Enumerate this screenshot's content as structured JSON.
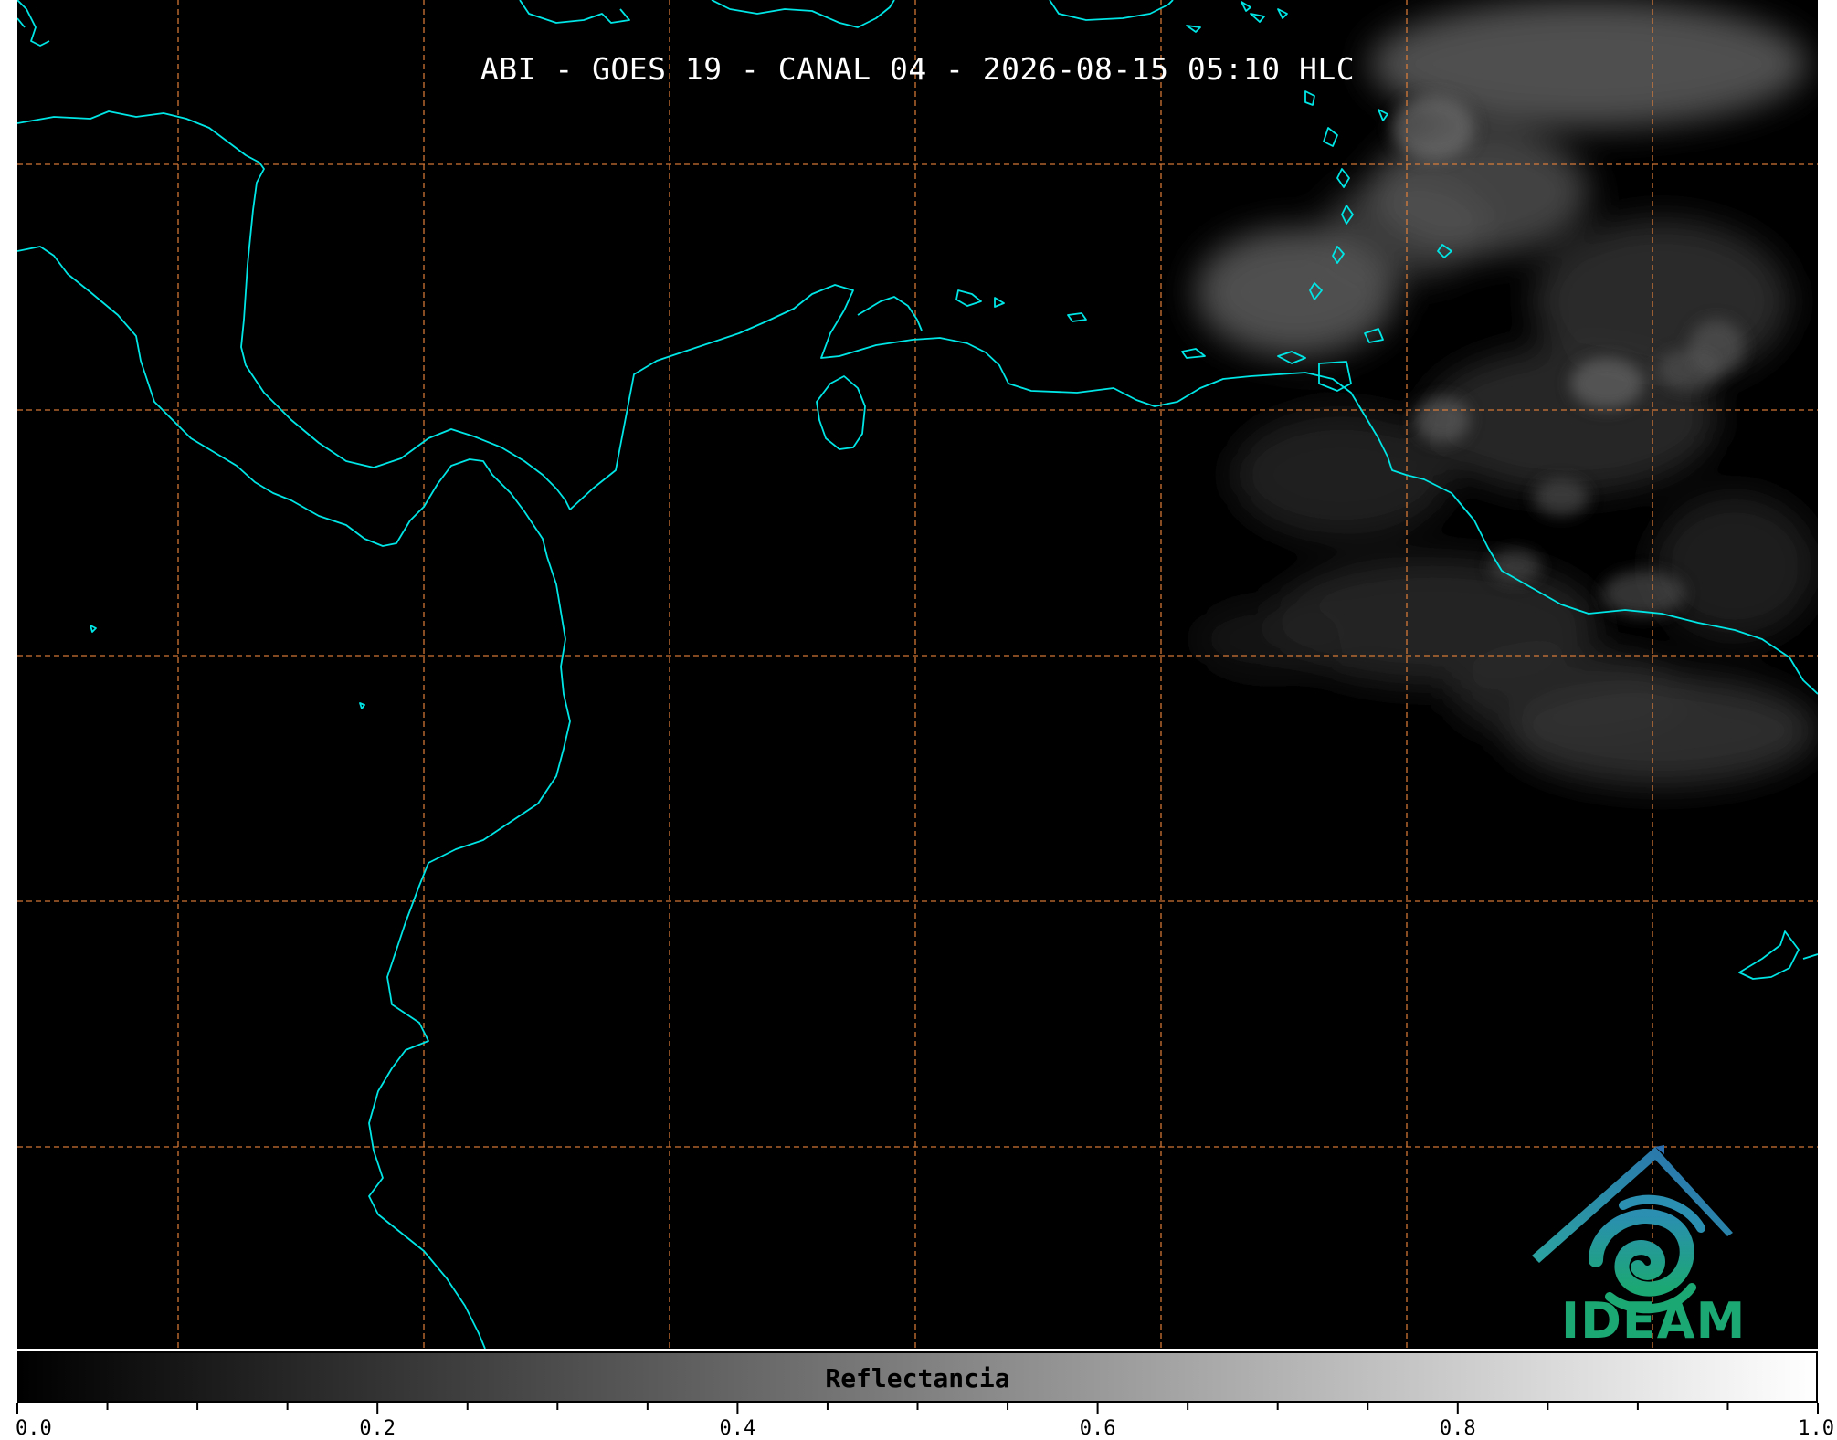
{
  "map": {
    "title": "ABI - GOES 19 - CANAL 04 - 2026-08-15 05:10 HLC",
    "background_color": "#000000",
    "coastline_color": "#00e5e5",
    "gridline_color": "#e8823a",
    "gridline_style": "dashed",
    "cloud_color": "#a0a0a0"
  },
  "logo": {
    "text": "IDEAM",
    "icon": "ideam-logo-icon",
    "text_color": "#1ca873",
    "roof_color": "#2a6fb0"
  },
  "colorbar": {
    "label": "Reflectancia",
    "min": 0.0,
    "max": 1.0,
    "gradient": [
      "#000000",
      "#ffffff"
    ],
    "tick_labels": [
      "0.0",
      "0.2",
      "0.4",
      "0.6",
      "0.8",
      "1.0"
    ]
  }
}
